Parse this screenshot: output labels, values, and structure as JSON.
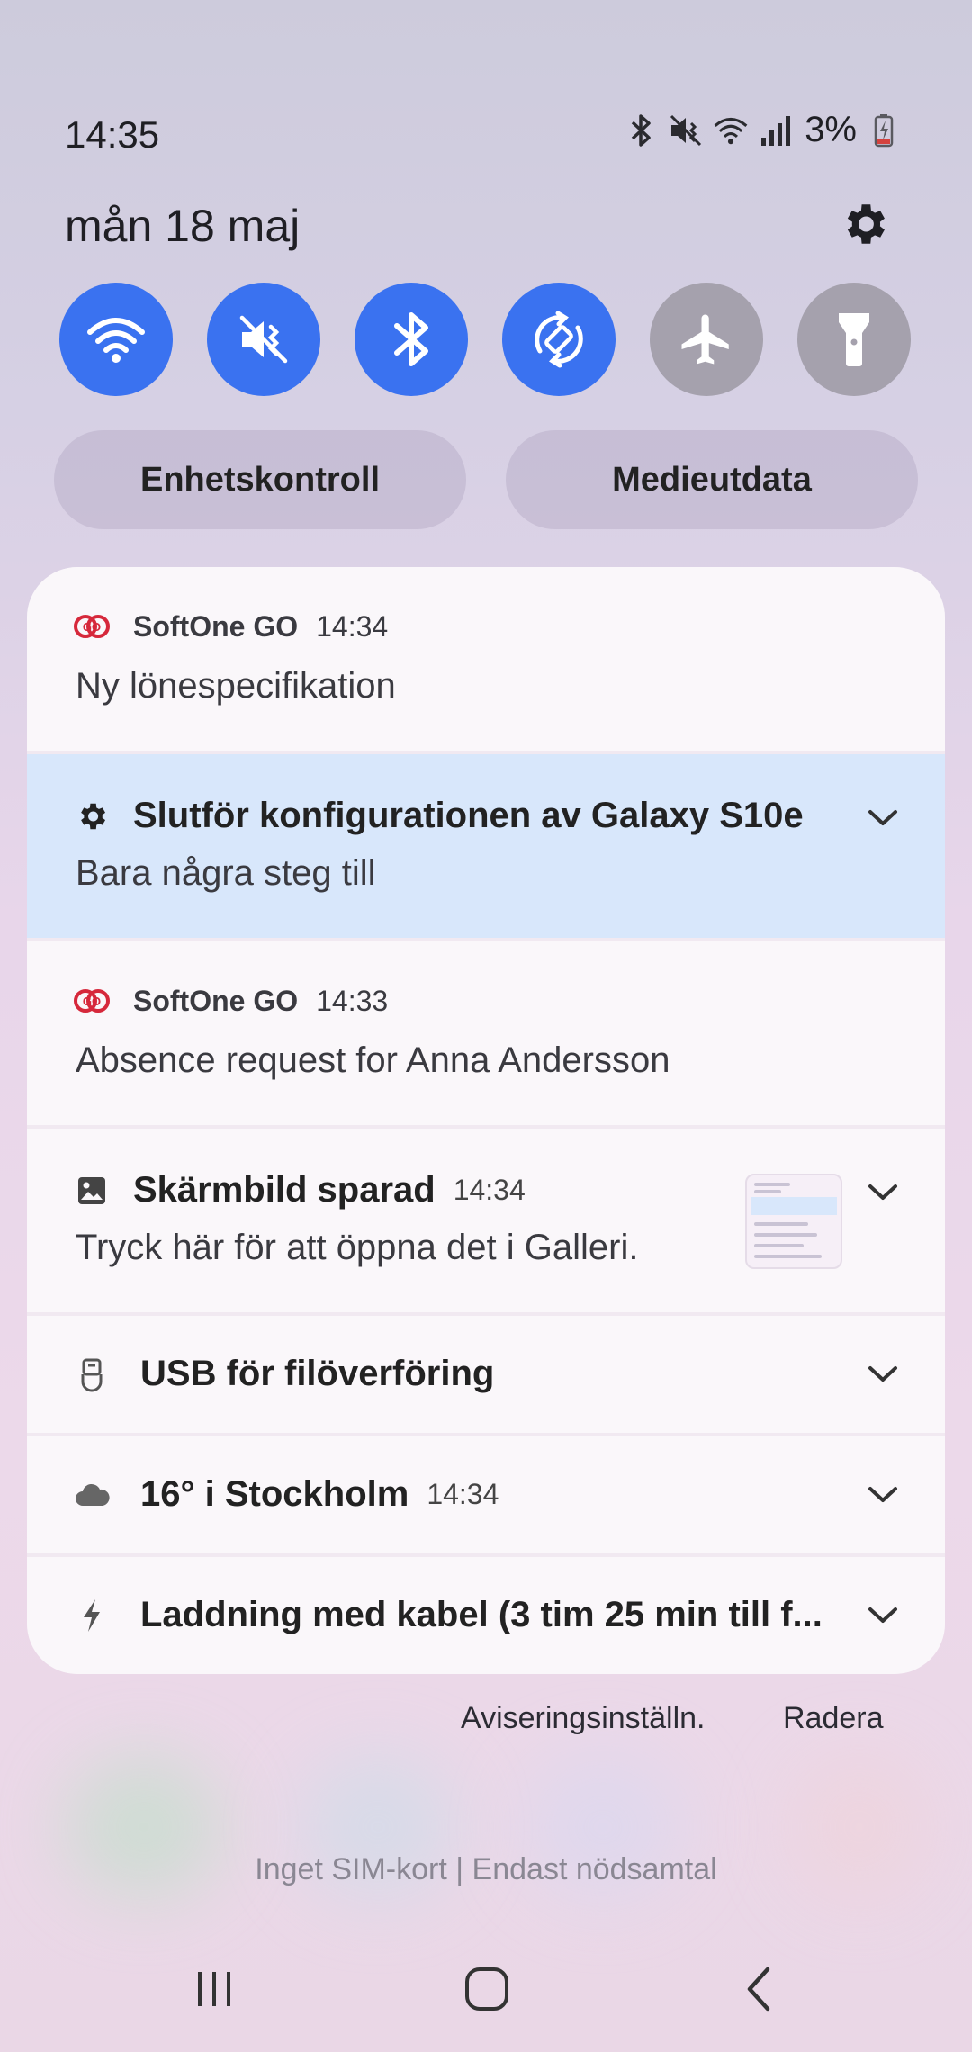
{
  "status_bar": {
    "time": "14:35",
    "battery_percent": "3%",
    "icons": [
      "bluetooth-icon",
      "mute-icon",
      "wifi-icon",
      "signal-icon",
      "battery-charging-icon"
    ]
  },
  "header": {
    "date": "mån 18 maj"
  },
  "quick_toggles": [
    {
      "name": "wifi",
      "state": "on"
    },
    {
      "name": "mute",
      "state": "on"
    },
    {
      "name": "bluetooth",
      "state": "on"
    },
    {
      "name": "auto-rotate",
      "state": "on"
    },
    {
      "name": "airplane-mode",
      "state": "off"
    },
    {
      "name": "flashlight",
      "state": "off"
    }
  ],
  "pills": {
    "device_control": "Enhetskontroll",
    "media_output": "Medieutdata"
  },
  "notifications": [
    {
      "app": "SoftOne GO",
      "time": "14:34",
      "body": "Ny lönespecifikation"
    },
    {
      "title": "Slutför konfigurationen av Galaxy S10e",
      "body": "Bara några steg till"
    },
    {
      "app": "SoftOne GO",
      "time": "14:33",
      "body": "Absence request for Anna Andersson"
    },
    {
      "title": "Skärmbild sparad",
      "time": "14:34",
      "body": "Tryck här för att öppna det i Galleri."
    },
    {
      "title": "USB för filöverföring"
    },
    {
      "title": "16° i Stockholm",
      "time": "14:34"
    },
    {
      "title": "Laddning med kabel (3 tim 25 min till f..."
    }
  ],
  "footer": {
    "notification_settings": "Aviseringsinställn.",
    "clear": "Radera",
    "sim_status": "Inget SIM-kort | Endast nödsamtal"
  },
  "colors": {
    "toggle_on": "#3a72f0",
    "toggle_off": "#a5a1ad",
    "highlight_card": "#d8e7fb",
    "softone_red": "#d6283b"
  }
}
